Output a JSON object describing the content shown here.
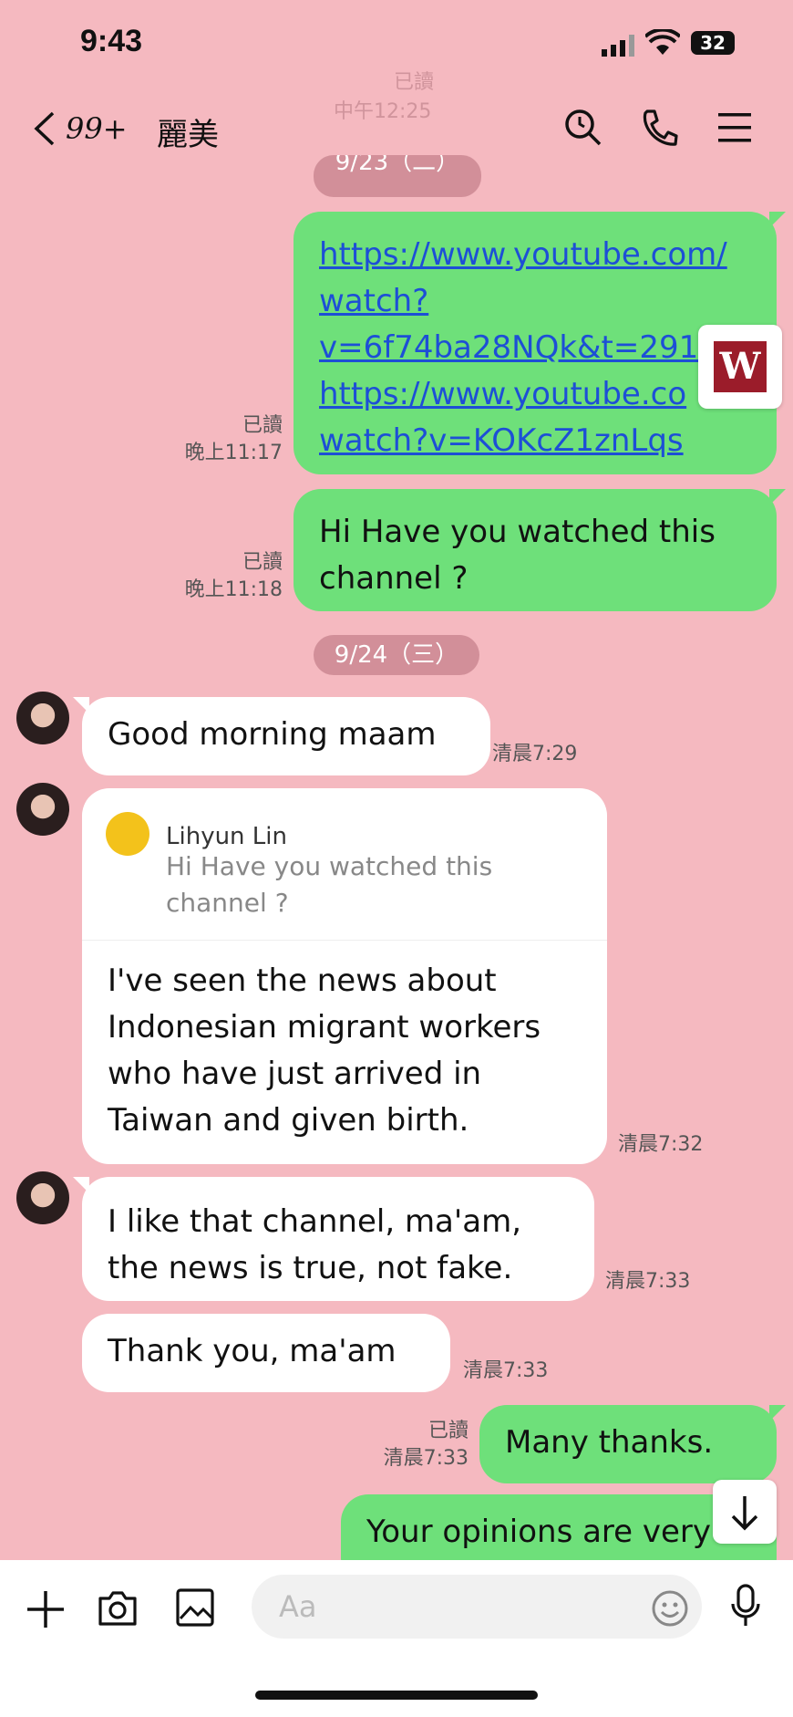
{
  "status_bar": {
    "time": "9:43",
    "battery": "32"
  },
  "header": {
    "back_count": "99+",
    "contact_name": "麗美",
    "faint_read": "已讀",
    "faint_time": "中午12:25"
  },
  "dates": {
    "first": "9/23（二）",
    "second": "9/24（三）"
  },
  "messages": {
    "m1": {
      "links": [
        "https://www.youtube.com/",
        "watch?",
        "v=6f74ba28NQk&t=291",
        "https://www.youtube.co",
        "watch?v=KOKcZ1znLqs"
      ],
      "read": "已讀",
      "time": "晚上11:17"
    },
    "m2": {
      "text": "Hi Have you watched this channel ?",
      "read": "已讀",
      "time": "晚上11:18"
    },
    "m3": {
      "text": "Good morning maam",
      "time": "清晨7:29"
    },
    "m4": {
      "reply_name": "Lihyun Lin",
      "reply_text": "Hi Have you watched this channel ?",
      "text": "I've seen the news about Indonesian migrant workers who have just arrived in Taiwan and given birth.",
      "time": "清晨7:32"
    },
    "m5": {
      "text": "I like that channel, ma'am, the news is true, not fake.",
      "time": "清晨7:33"
    },
    "m6": {
      "text": "Thank you, ma'am",
      "time": "清晨7:33"
    },
    "m7": {
      "text": "Many thanks.",
      "read": "已讀",
      "time": "清晨7:33"
    },
    "m8": {
      "text": "Your opinions are very"
    }
  },
  "composer": {
    "placeholder": "Aa"
  },
  "colors": {
    "background": "#f5b9c0",
    "sent": "#6ee07a",
    "received": "#ffffff",
    "link": "#1d4fd6"
  }
}
